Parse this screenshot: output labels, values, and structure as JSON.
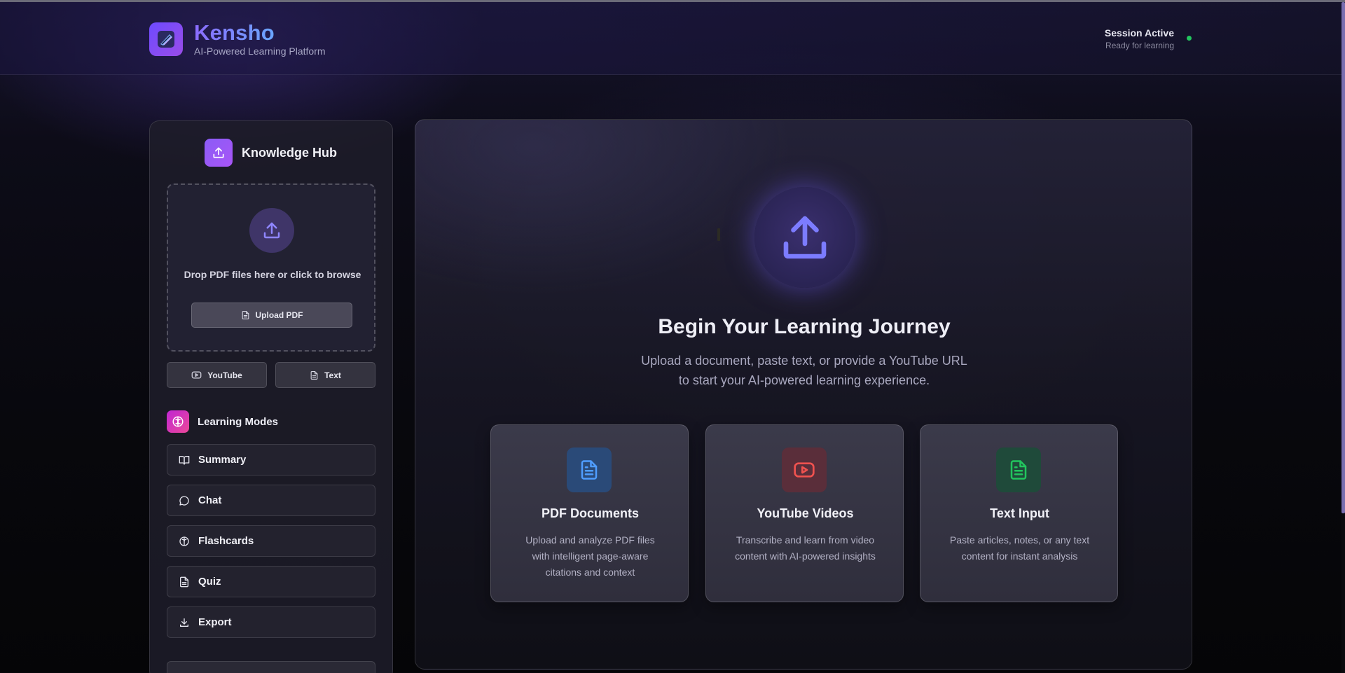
{
  "header": {
    "brand": "Kensho",
    "tagline": "AI-Powered Learning Platform",
    "session_status": "Session Active",
    "session_sub": "Ready for learning"
  },
  "sidebar": {
    "hub_title": "Knowledge Hub",
    "dropzone_text": "Drop PDF files here or click to browse",
    "upload_label": "Upload PDF",
    "youtube_label": "YouTube",
    "text_label": "Text",
    "modes_title": "Learning Modes",
    "modes": [
      {
        "label": "Summary",
        "icon": "book-open-icon"
      },
      {
        "label": "Chat",
        "icon": "chat-bubble-icon"
      },
      {
        "label": "Flashcards",
        "icon": "brain-icon"
      },
      {
        "label": "Quiz",
        "icon": "document-icon"
      },
      {
        "label": "Export",
        "icon": "download-icon"
      }
    ]
  },
  "main": {
    "hero_title": "Begin Your Learning Journey",
    "hero_subtitle_line1": "Upload a document, paste text, or provide a YouTube URL",
    "hero_subtitle_line2": "to start your AI-powered learning experience.",
    "features": [
      {
        "title": "PDF Documents",
        "desc": "Upload and analyze PDF files with intelligent page-aware citations and context",
        "icon": "document-icon",
        "color": "#3b82f6"
      },
      {
        "title": "YouTube Videos",
        "desc": "Transcribe and learn from video content with AI-powered insights",
        "icon": "youtube-icon",
        "color": "#ef4444"
      },
      {
        "title": "Text Input",
        "desc": "Paste articles, notes, or any text content for instant analysis",
        "icon": "text-document-icon",
        "color": "#22c55e"
      }
    ]
  },
  "colors": {
    "accent": "#7c5cff",
    "status_active": "#22c55e"
  }
}
